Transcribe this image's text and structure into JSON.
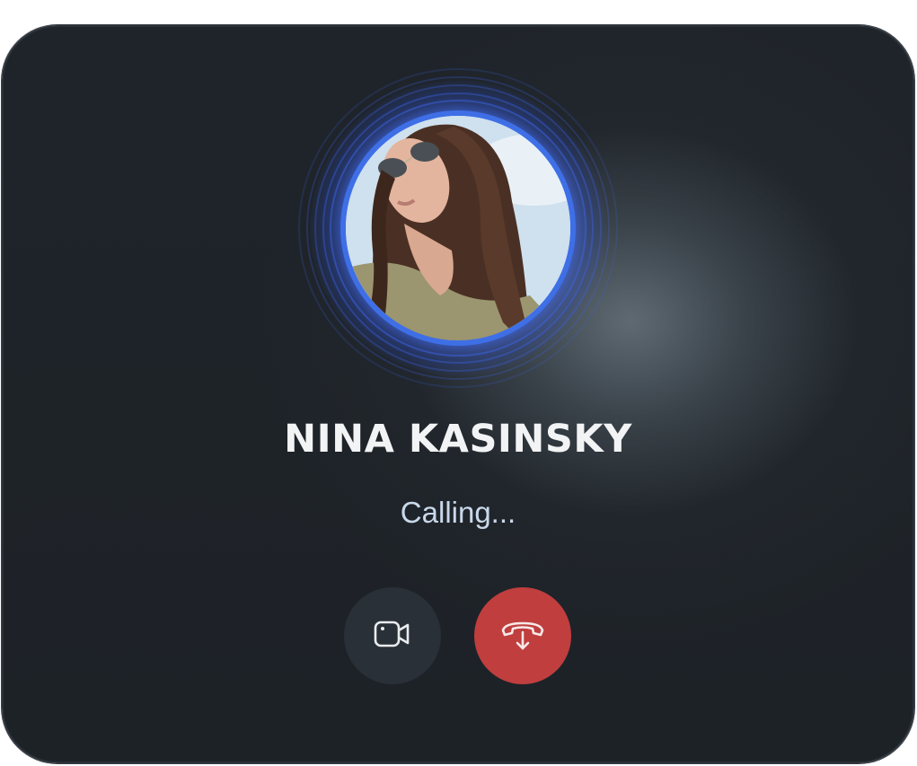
{
  "contact": {
    "name": "NINA KASINSKY",
    "avatar_alt": "Contact photo"
  },
  "call": {
    "status": "Calling..."
  },
  "actions": {
    "video_icon": "video-camera-icon",
    "end_icon": "hang-up-phone-icon"
  },
  "colors": {
    "ring": "#3f6fe6",
    "end_call": "#c03e3e",
    "video_button": "#2a3037",
    "status_text": "#c9d8ea"
  }
}
